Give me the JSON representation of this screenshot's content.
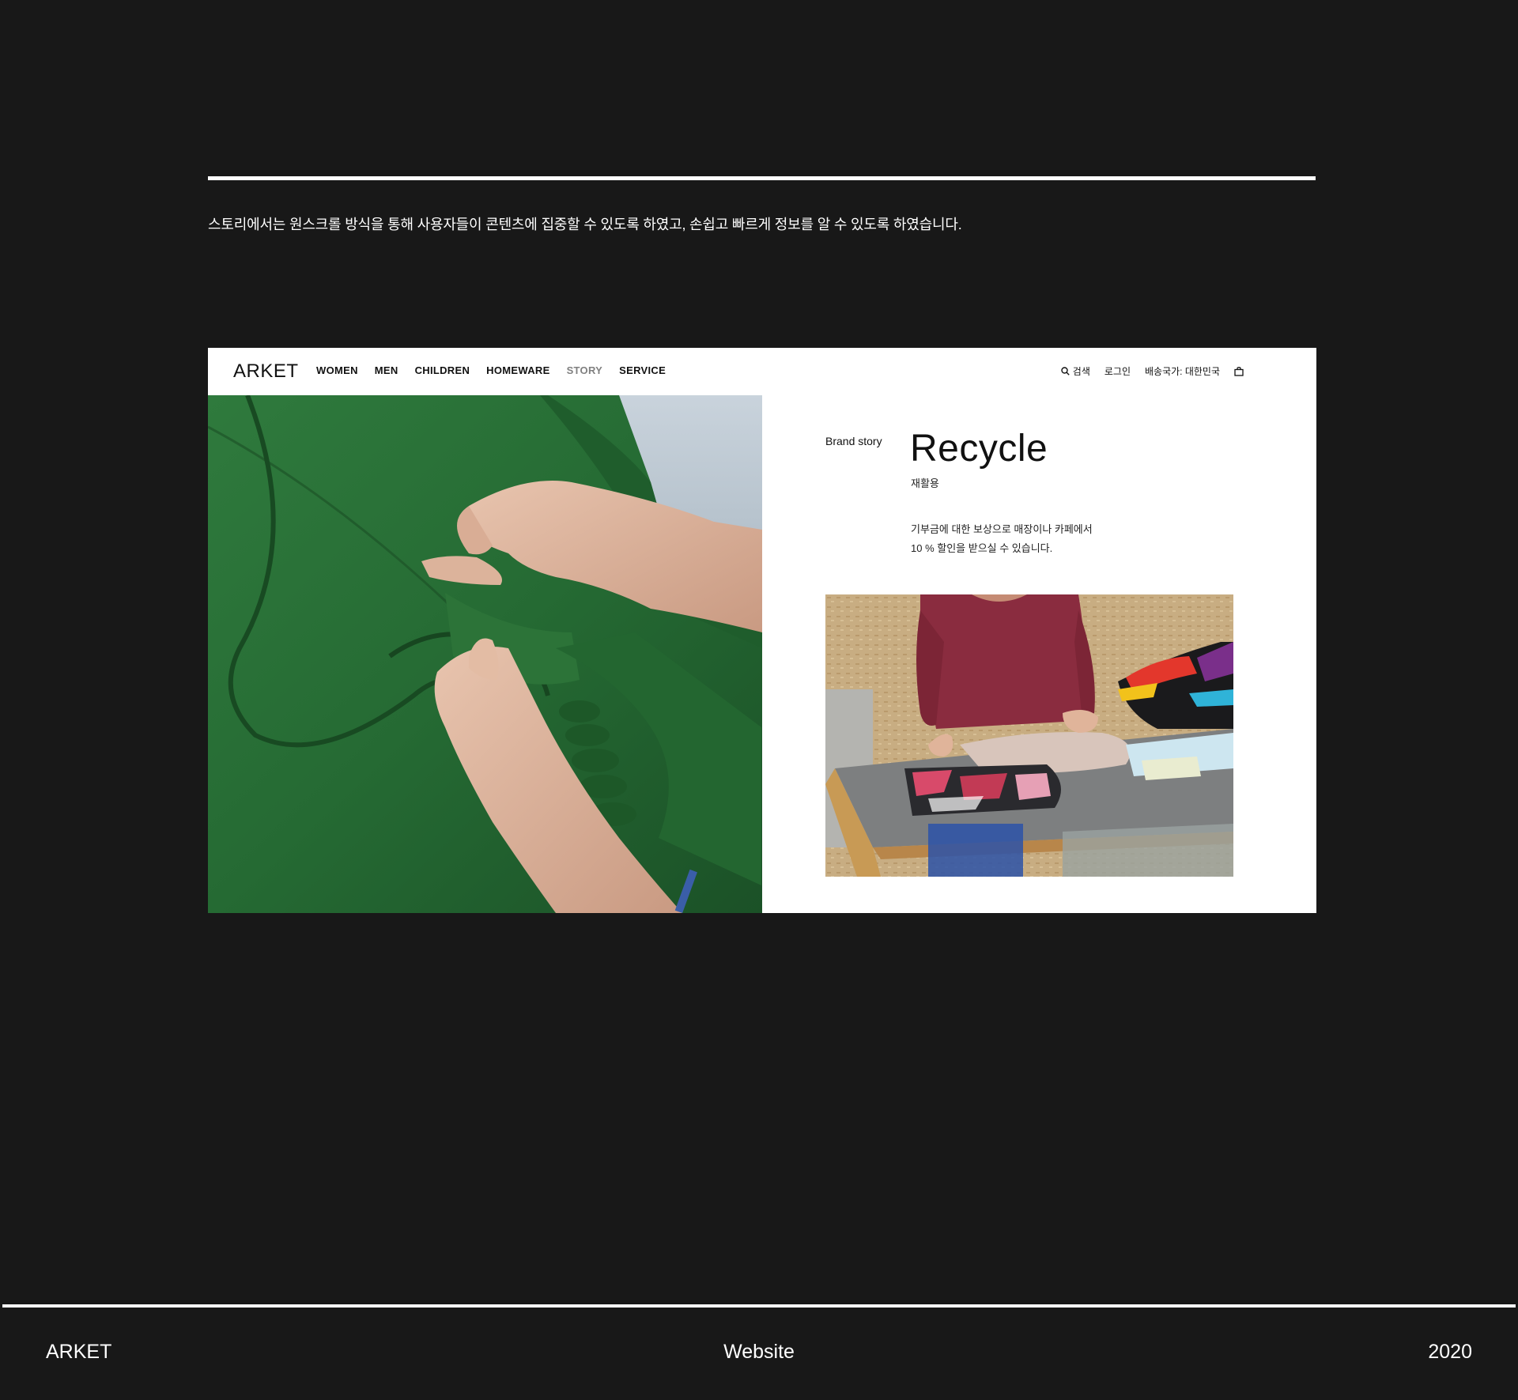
{
  "caption": "스토리에서는 원스크롤 방식을 통해 사용자들이 콘텐츠에 집중할 수 있도록 하였고, 손쉽고 빠르게 정보를 알 수 있도록 하였습니다.",
  "site": {
    "logo": "ARKET",
    "nav": [
      {
        "label": "WOMEN",
        "active": false
      },
      {
        "label": "MEN",
        "active": false
      },
      {
        "label": "CHILDREN",
        "active": false
      },
      {
        "label": "HOMEWARE",
        "active": false
      },
      {
        "label": "STORY",
        "active": true
      },
      {
        "label": "SERVICE",
        "active": false
      }
    ],
    "search_label": "검색",
    "login_label": "로그인",
    "shipping_label": "배송국가: 대한민국",
    "section_label": "Brand story",
    "title": "Recycle",
    "subtitle": "재활용",
    "description_line1": "기부금에 대한 보상으로 매장이나 카페에서",
    "description_line2": "10 % 할인을 받으실 수 있습니다."
  },
  "footer": {
    "left": "ARKET",
    "center": "Website",
    "right": "2020"
  },
  "colors": {
    "background": "#181818",
    "mockup_background": "#ffffff",
    "nav_inactive": "#111111",
    "nav_active": "#808080",
    "jacket_green": "#2a6b35"
  }
}
